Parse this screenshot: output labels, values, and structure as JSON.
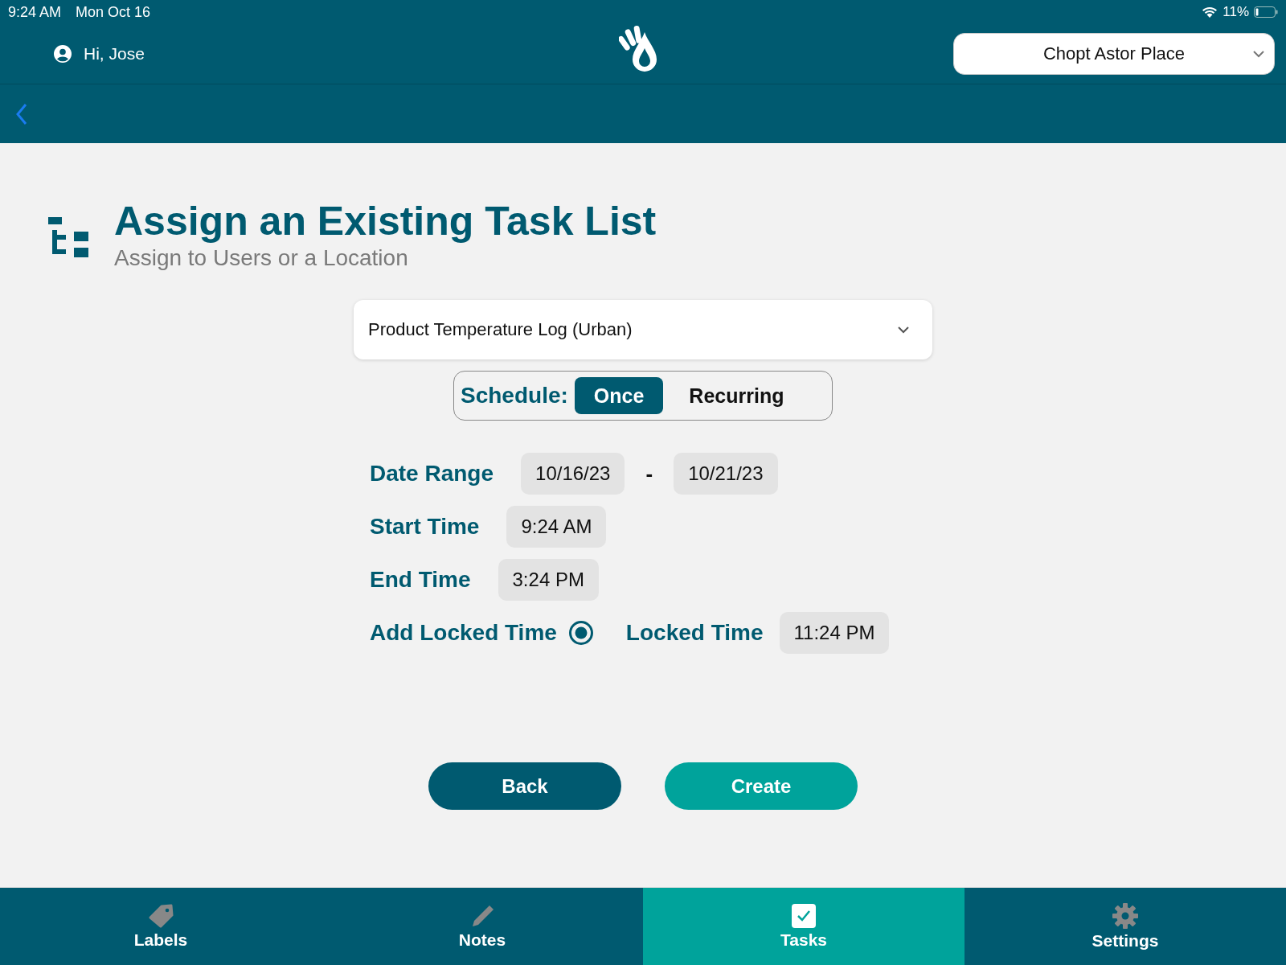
{
  "status_bar": {
    "time": "9:24 AM",
    "date": "Mon Oct 16",
    "battery": "11%"
  },
  "header": {
    "greeting": "Hi, Jose",
    "location": "Chopt Astor Place"
  },
  "page": {
    "title": "Assign an Existing Task List",
    "subtitle": "Assign to Users or a Location"
  },
  "task_list_select": {
    "value": "Product Temperature Log (Urban)"
  },
  "schedule": {
    "label": "Schedule:",
    "options": [
      {
        "label": "Once",
        "selected": true
      },
      {
        "label": "Recurring",
        "selected": false
      }
    ]
  },
  "date_range": {
    "label": "Date Range",
    "start": "10/16/23",
    "separator": "-",
    "end": "10/21/23"
  },
  "start_time": {
    "label": "Start Time",
    "value": "9:24 AM"
  },
  "end_time": {
    "label": "End Time",
    "value": "3:24 PM"
  },
  "locked": {
    "label": "Add Locked Time",
    "checked": true,
    "time_label": "Locked Time",
    "time_value": "11:24 PM"
  },
  "buttons": {
    "back": "Back",
    "create": "Create"
  },
  "tabs": [
    {
      "label": "Labels",
      "kind": "tag",
      "selected": false
    },
    {
      "label": "Notes",
      "kind": "pencil",
      "selected": false
    },
    {
      "label": "Tasks",
      "kind": "check",
      "selected": true
    },
    {
      "label": "Settings",
      "kind": "gear",
      "selected": false
    }
  ]
}
